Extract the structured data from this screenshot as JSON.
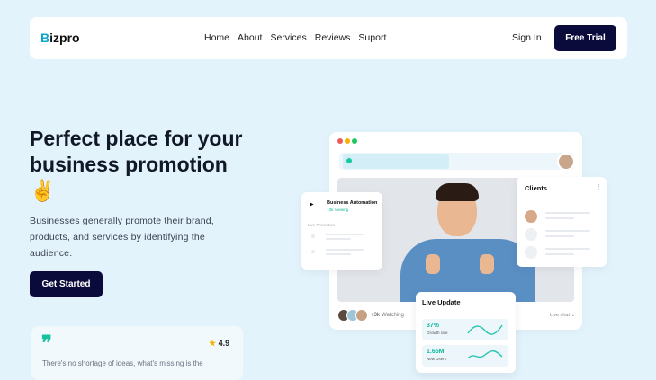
{
  "nav": {
    "logo_first": "B",
    "logo_rest": "izpro",
    "links": [
      "Home",
      "About",
      "Services",
      "Reviews",
      "Suport"
    ],
    "signin": "Sign In",
    "trial": "Free Trial"
  },
  "hero": {
    "title_text": "Perfect place for your business promotion",
    "emoji": "✌",
    "text": "Businesses generally promote their brand, products, and services by identifying the audience.",
    "cta": "Get Started"
  },
  "testimonial": {
    "quote_mark": "❞",
    "star": "★",
    "rating": "4.9",
    "text": "There's no shortage of ideas, what's missing is the"
  },
  "preview": {
    "traffic_colors": [
      "#ef5b5b",
      "#f5b301",
      "#22c55e"
    ],
    "automation": {
      "title": "Business Automation",
      "subtitle": "+3k Viewing",
      "section": "Live Promotion"
    },
    "viewers": {
      "count": "+3k",
      "label": "Watching"
    },
    "live_chat": "Live chat ⌄",
    "clients": {
      "title": "Clients",
      "more": "⋮"
    },
    "live_update": {
      "title": "Live Update",
      "more": "⋮",
      "stats": [
        {
          "value": "37%",
          "label": "Growth rate"
        },
        {
          "value": "1.65M",
          "label": "New Users"
        }
      ]
    }
  }
}
